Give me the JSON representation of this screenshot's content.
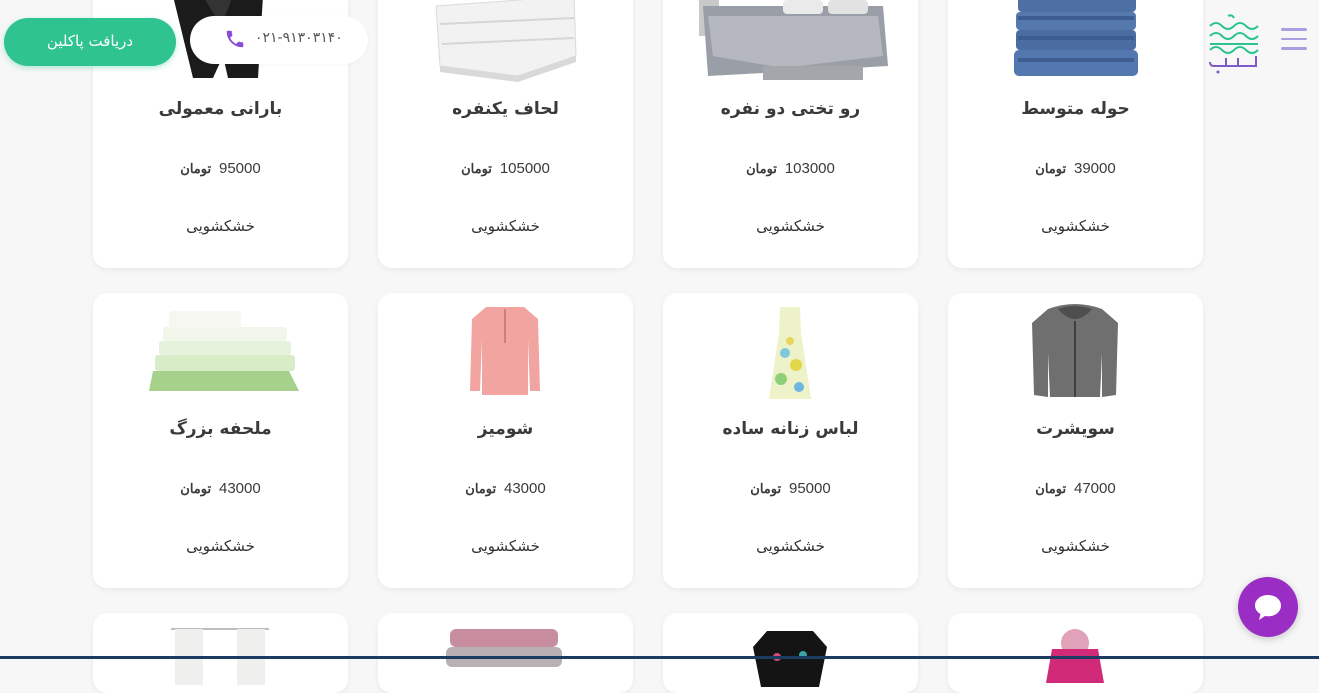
{
  "header": {
    "cta_label": "دریافت پاکلین",
    "phone": "۰۲۱-۹۱۳۰۳۱۴۰",
    "logo_text": "پاکلین"
  },
  "currency": "تومان",
  "products": [
    {
      "title": "حوله متوسط",
      "price": "39000",
      "service": "خشکشویی",
      "icon": "towel-stack-image"
    },
    {
      "title": "رو تختی دو نفره",
      "price": "103000",
      "service": "خشکشویی",
      "icon": "bedspread-image"
    },
    {
      "title": "لحاف یکنفره",
      "price": "105000",
      "service": "خشکشویی",
      "icon": "quilt-image"
    },
    {
      "title": "بارانی معمولی",
      "price": "95000",
      "service": "خشکشویی",
      "icon": "raincoat-image"
    },
    {
      "title": "سویشرت",
      "price": "47000",
      "service": "خشکشویی",
      "icon": "hoodie-image"
    },
    {
      "title": "لباس زنانه ساده",
      "price": "95000",
      "service": "خشکشویی",
      "icon": "dress-image"
    },
    {
      "title": "شومیز",
      "price": "43000",
      "service": "خشکشویی",
      "icon": "blouse-image"
    },
    {
      "title": "ملحفه بزرگ",
      "price": "43000",
      "service": "خشکشویی",
      "icon": "sheets-image"
    }
  ],
  "colors": {
    "accent": "#2ec38f",
    "chat": "#9a2dc3",
    "menu": "#a99ee0",
    "background": "#f7f7f8"
  }
}
